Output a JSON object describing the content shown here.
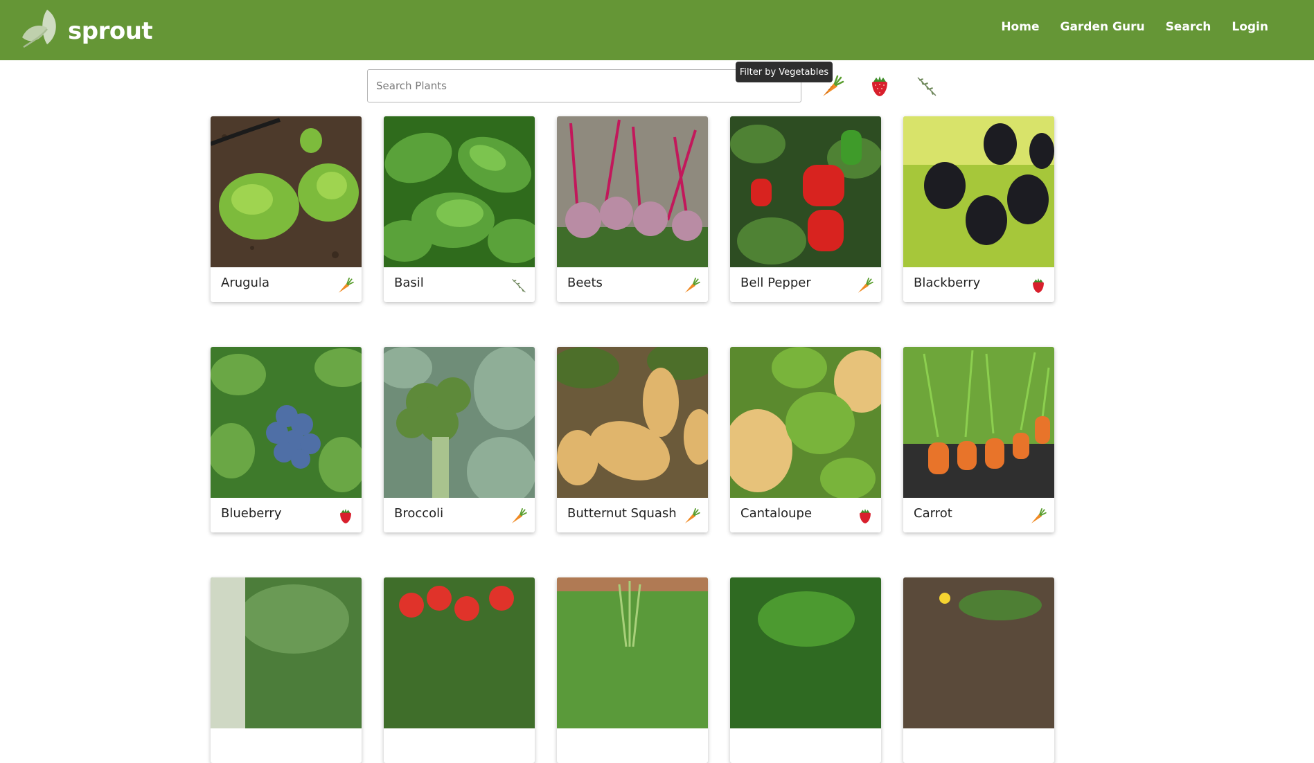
{
  "brand": {
    "name": "sprout"
  },
  "nav": {
    "home": "Home",
    "garden_guru": "Garden Guru",
    "search": "Search",
    "login": "Login"
  },
  "search": {
    "placeholder": "Search Plants",
    "value": ""
  },
  "filters": {
    "tooltip": "Filter by Vegetables",
    "items": [
      {
        "name": "vegetables",
        "icon": "carrot-icon"
      },
      {
        "name": "fruits",
        "icon": "strawberry-icon"
      },
      {
        "name": "herbs",
        "icon": "herb-sprig-icon"
      }
    ]
  },
  "colors": {
    "header": "#659636",
    "card_shadow": "rgba(0,0,0,0.25)"
  },
  "plants": [
    {
      "name": "Arugula",
      "category": "vegetable",
      "icon": "carrot-icon"
    },
    {
      "name": "Basil",
      "category": "herb",
      "icon": "herb-sprig-icon"
    },
    {
      "name": "Beets",
      "category": "vegetable",
      "icon": "carrot-icon"
    },
    {
      "name": "Bell Pepper",
      "category": "vegetable",
      "icon": "carrot-icon"
    },
    {
      "name": "Blackberry",
      "category": "fruit",
      "icon": "strawberry-icon"
    },
    {
      "name": "Blueberry",
      "category": "fruit",
      "icon": "strawberry-icon"
    },
    {
      "name": "Broccoli",
      "category": "vegetable",
      "icon": "carrot-icon"
    },
    {
      "name": "Butternut Squash",
      "category": "vegetable",
      "icon": "carrot-icon"
    },
    {
      "name": "Cantaloupe",
      "category": "fruit",
      "icon": "strawberry-icon"
    },
    {
      "name": "Carrot",
      "category": "vegetable",
      "icon": "carrot-icon"
    }
  ]
}
